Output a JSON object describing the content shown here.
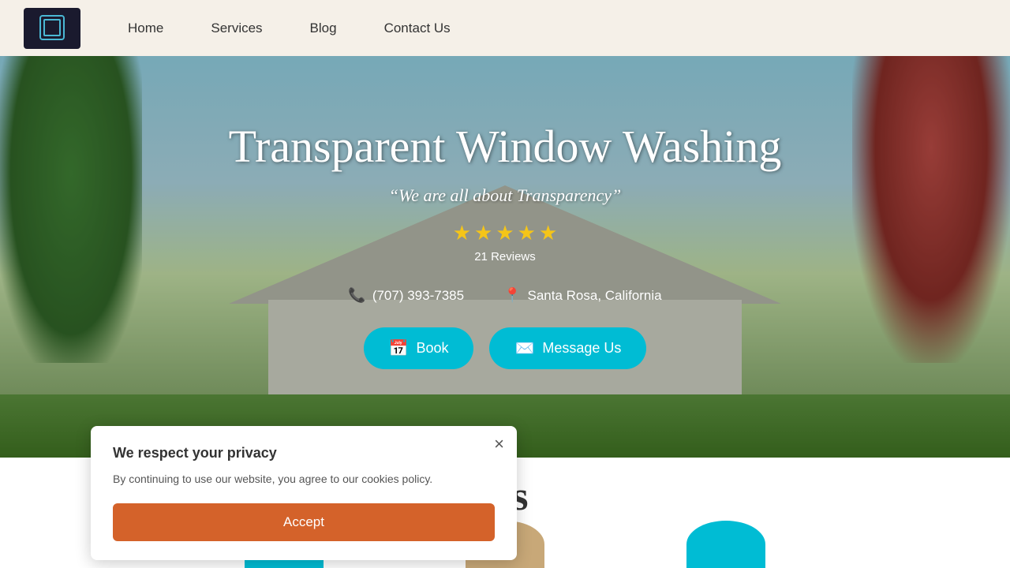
{
  "nav": {
    "home": "Home",
    "services": "Services",
    "blog": "Blog",
    "contact": "Contact Us",
    "logo_alt": "Transparent Window Washing Logo"
  },
  "hero": {
    "title": "Transparent Window Washing",
    "subtitle": "“We are all about Transparency”",
    "stars_count": 5,
    "reviews": "21 Reviews",
    "phone": "(707) 393-7385",
    "location": "Santa Rosa, California",
    "book_label": "Book",
    "message_label": "Message Us"
  },
  "below_fold": {
    "heading": "t Us"
  },
  "cookie": {
    "title": "We respect your privacy",
    "body": "By continuing to use our website, you agree to our cookies policy.",
    "accept_label": "Accept"
  }
}
